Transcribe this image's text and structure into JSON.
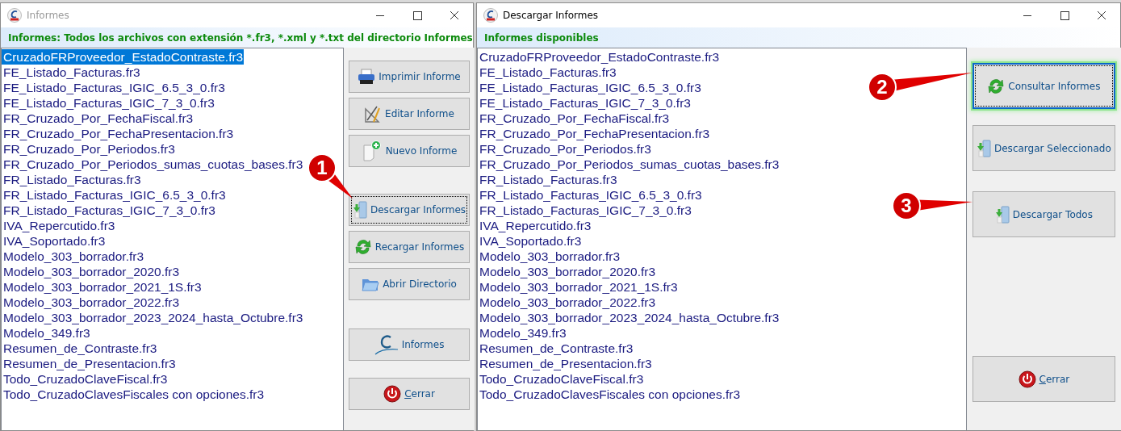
{
  "windows": [
    {
      "title": "Informes",
      "title_active": false,
      "heading": "Informes: Todos los archivos con extensión *.fr3, *.xml y *.txt del directorio Informes",
      "files": [
        {
          "name": "CruzadoFRProveedor_EstadoContraste.fr3",
          "selected": true
        },
        {
          "name": "FE_Listado_Facturas.fr3",
          "selected": false
        },
        {
          "name": "FE_Listado_Facturas_IGIC_6.5_3_0.fr3",
          "selected": false
        },
        {
          "name": "FE_Listado_Facturas_IGIC_7_3_0.fr3",
          "selected": false
        },
        {
          "name": "FR_Cruzado_Por_FechaFiscal.fr3",
          "selected": false
        },
        {
          "name": "FR_Cruzado_Por_FechaPresentacion.fr3",
          "selected": false
        },
        {
          "name": "FR_Cruzado_Por_Periodos.fr3",
          "selected": false
        },
        {
          "name": "FR_Cruzado_Por_Periodos_sumas_cuotas_bases.fr3",
          "selected": false
        },
        {
          "name": "FR_Listado_Facturas.fr3",
          "selected": false
        },
        {
          "name": "FR_Listado_Facturas_IGIC_6.5_3_0.fr3",
          "selected": false
        },
        {
          "name": "FR_Listado_Facturas_IGIC_7_3_0.fr3",
          "selected": false
        },
        {
          "name": "IVA_Repercutido.fr3",
          "selected": false
        },
        {
          "name": "IVA_Soportado.fr3",
          "selected": false
        },
        {
          "name": "Modelo_303_borrador.fr3",
          "selected": false
        },
        {
          "name": "Modelo_303_borrador_2020.fr3",
          "selected": false
        },
        {
          "name": "Modelo_303_borrador_2021_1S.fr3",
          "selected": false
        },
        {
          "name": "Modelo_303_borrador_2022.fr3",
          "selected": false
        },
        {
          "name": "Modelo_303_borrador_2023_2024_hasta_Octubre.fr3",
          "selected": false
        },
        {
          "name": "Modelo_349.fr3",
          "selected": false
        },
        {
          "name": "Resumen_de_Contraste.fr3",
          "selected": false
        },
        {
          "name": "Resumen_de_Presentacion.fr3",
          "selected": false
        },
        {
          "name": "Todo_CruzadoClaveFiscal.fr3",
          "selected": false
        },
        {
          "name": "Todo_CruzadoClavesFiscales con opciones.fr3",
          "selected": false
        }
      ],
      "button_groups": [
        [
          {
            "label": "Imprimir Informe",
            "kind": "printer",
            "focused": false,
            "highlighted": false
          },
          {
            "label": "Editar Informe",
            "kind": "drafting",
            "focused": false,
            "highlighted": false
          },
          {
            "label": "Nuevo Informe",
            "kind": "newdoc",
            "focused": false,
            "highlighted": false
          }
        ],
        [
          {
            "label": "Descargar Informes",
            "kind": "download",
            "focused": true,
            "highlighted": false
          },
          {
            "label": "Recargar Informes",
            "kind": "refresh",
            "focused": false,
            "highlighted": false
          },
          {
            "label": "Abrir Directorio",
            "kind": "folder",
            "focused": false,
            "highlighted": false
          }
        ],
        [
          {
            "label": "Informes",
            "kind": "logo",
            "focused": false,
            "highlighted": false
          }
        ],
        [
          {
            "label": "Cerrar",
            "kind": "power",
            "focused": false,
            "highlighted": false
          }
        ]
      ]
    },
    {
      "title": "Descargar Informes",
      "title_active": true,
      "heading": "Informes disponibles",
      "files": [
        {
          "name": "CruzadoFRProveedor_EstadoContraste.fr3",
          "selected": false
        },
        {
          "name": "FE_Listado_Facturas.fr3",
          "selected": false
        },
        {
          "name": "FE_Listado_Facturas_IGIC_6.5_3_0.fr3",
          "selected": false
        },
        {
          "name": "FE_Listado_Facturas_IGIC_7_3_0.fr3",
          "selected": false
        },
        {
          "name": "FR_Cruzado_Por_FechaFiscal.fr3",
          "selected": false
        },
        {
          "name": "FR_Cruzado_Por_FechaPresentacion.fr3",
          "selected": false
        },
        {
          "name": "FR_Cruzado_Por_Periodos.fr3",
          "selected": false
        },
        {
          "name": "FR_Cruzado_Por_Periodos_sumas_cuotas_bases.fr3",
          "selected": false
        },
        {
          "name": "FR_Listado_Facturas.fr3",
          "selected": false
        },
        {
          "name": "FR_Listado_Facturas_IGIC_6.5_3_0.fr3",
          "selected": false
        },
        {
          "name": "FR_Listado_Facturas_IGIC_7_3_0.fr3",
          "selected": false
        },
        {
          "name": "IVA_Repercutido.fr3",
          "selected": false
        },
        {
          "name": "IVA_Soportado.fr3",
          "selected": false
        },
        {
          "name": "Modelo_303_borrador.fr3",
          "selected": false
        },
        {
          "name": "Modelo_303_borrador_2020.fr3",
          "selected": false
        },
        {
          "name": "Modelo_303_borrador_2021_1S.fr3",
          "selected": false
        },
        {
          "name": "Modelo_303_borrador_2022.fr3",
          "selected": false
        },
        {
          "name": "Modelo_303_borrador_2023_2024_hasta_Octubre.fr3",
          "selected": false
        },
        {
          "name": "Modelo_349.fr3",
          "selected": false
        },
        {
          "name": "Resumen_de_Contraste.fr3",
          "selected": false
        },
        {
          "name": "Resumen_de_Presentacion.fr3",
          "selected": false
        },
        {
          "name": "Todo_CruzadoClaveFiscal.fr3",
          "selected": false
        },
        {
          "name": "Todo_CruzadoClavesFiscales con opciones.fr3",
          "selected": false
        }
      ],
      "button_groups": [
        [
          {
            "label": "Consultar Informes",
            "kind": "refresh",
            "focused": true,
            "highlighted": true
          }
        ],
        [
          {
            "label": "Descargar Seleccionado",
            "kind": "download",
            "focused": false,
            "highlighted": false
          }
        ],
        [
          {
            "label": "Descargar Todos",
            "kind": "download",
            "focused": false,
            "highlighted": false
          }
        ],
        [
          {
            "label": "Cerrar",
            "kind": "power",
            "focused": false,
            "highlighted": false
          }
        ]
      ]
    }
  ],
  "callouts": [
    {
      "number": "1"
    },
    {
      "number": "2"
    },
    {
      "number": "3"
    }
  ]
}
